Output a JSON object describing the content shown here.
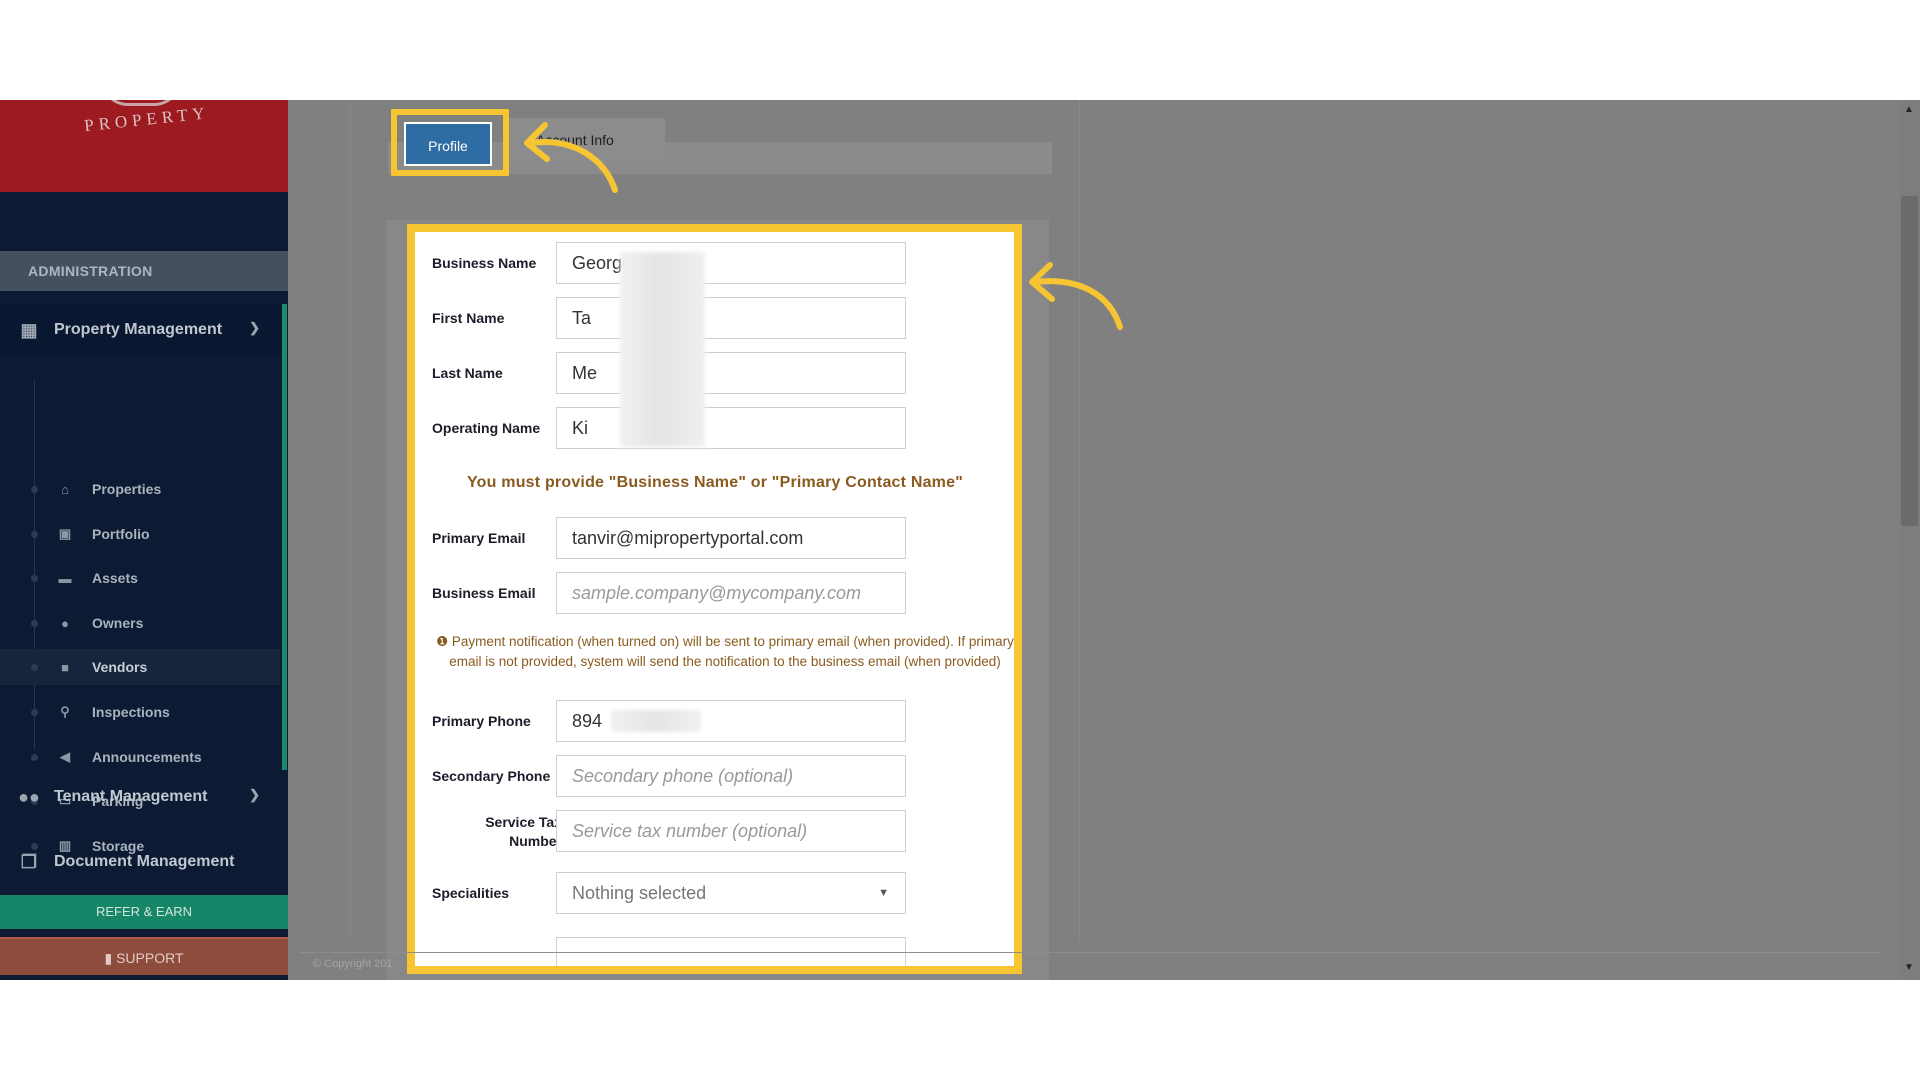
{
  "brand": {
    "name": "PROPERTY"
  },
  "sidebar": {
    "admin_label": "ADMINISTRATION",
    "groups": [
      {
        "label": "Property Management",
        "icon": "building-icon"
      },
      {
        "label": "Tenant Management",
        "icon": "users-icon"
      },
      {
        "label": "Document Management",
        "icon": "documents-icon"
      }
    ],
    "items": [
      {
        "label": "Properties",
        "icon": "home-icon"
      },
      {
        "label": "Portfolio",
        "icon": "portfolio-icon"
      },
      {
        "label": "Assets",
        "icon": "archive-icon"
      },
      {
        "label": "Owners",
        "icon": "user-icon"
      },
      {
        "label": "Vendors",
        "icon": "briefcase-icon"
      },
      {
        "label": "Inspections",
        "icon": "search-icon"
      },
      {
        "label": "Announcements",
        "icon": "megaphone-icon"
      },
      {
        "label": "Parking",
        "icon": "car-icon"
      },
      {
        "label": "Storage",
        "icon": "storage-icon"
      }
    ],
    "refer_label": "REFER & EARN",
    "support_label": "SUPPORT"
  },
  "tabs": {
    "profile": "Profile",
    "account": "Account Info"
  },
  "form": {
    "business_name": {
      "label": "Business Name",
      "value": "George"
    },
    "first_name": {
      "label": "First Name",
      "value": "Ta"
    },
    "last_name": {
      "label": "Last Name",
      "value": "Me"
    },
    "operating_name": {
      "label": "Operating Name",
      "value": "Ki"
    },
    "warning": "You must provide \"Business Name\" or \"Primary Contact Name\"",
    "primary_email": {
      "label": "Primary Email",
      "value": "tanvir@mipropertyportal.com"
    },
    "business_email": {
      "label": "Business Email",
      "placeholder": "sample.company@mycompany.com"
    },
    "note": "Payment notification (when turned on) will be sent to primary email (when provided). If primary email is not provided, system will send the notification to the business email (when provided)",
    "primary_phone": {
      "label": "Primary Phone",
      "value": "894"
    },
    "secondary_phone": {
      "label": "Secondary Phone",
      "placeholder": "Secondary phone (optional)"
    },
    "service_tax": {
      "label": "Service Tax Number",
      "placeholder": "Service tax number (optional)"
    },
    "specialities": {
      "label": "Specialities",
      "value": "Nothing selected"
    }
  },
  "footer": {
    "copyright": "© Copyright 201"
  },
  "colors": {
    "highlight": "#f7c531",
    "primary_tab": "#2e6da4",
    "sidebar": "#0c1b33",
    "brand": "#9c1a20"
  }
}
